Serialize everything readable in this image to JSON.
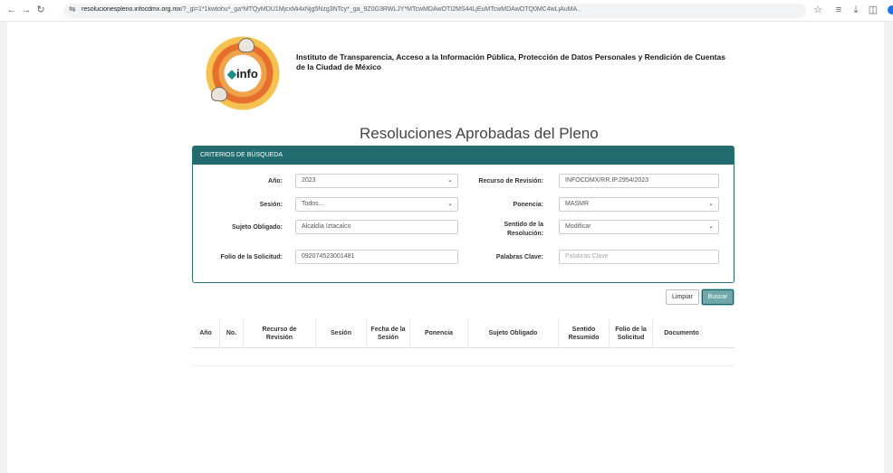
{
  "browser": {
    "url_host": "resolucionespleno.infocdmx.org.mx",
    "url_rest": "/?_gl=1*1kwtohu*_ga*MTQyMDU1MjcxMi4xNjg5Nzg3NTcy*_ga_9Z0G3RWLJY*MTcwMDAwOTI2MS44LjEuMTcwMDAwOTQ0MC4wLjAuMA.."
  },
  "header": {
    "logo_text": "info",
    "institution": "Instituto de Transparencia, Acceso a la Información Pública, Protección de Datos Personales y Rendición de Cuentas de la Ciudad de México"
  },
  "title": "Resoluciones Aprobadas del Pleno",
  "panel": {
    "heading": "CRITERIOS DE BÚSQUEDA",
    "ano_label": "Año:",
    "ano_value": "2023",
    "recurso_label": "Recurso de Revisión:",
    "recurso_value": "INFOCDMX/RR.IP.2954/2023",
    "sesion_label": "Sesión:",
    "sesion_value": "Todos...",
    "ponencia_label": "Ponencia:",
    "ponencia_value": "MASMR",
    "sujeto_label": "Sujeto Obligado:",
    "sujeto_value": "Alcaldía Iztacalco",
    "sentido_label_1": "Sentido de la",
    "sentido_label_2": "Resolución:",
    "sentido_value": "Modificar",
    "folio_label": "Folio de la Solicitud:",
    "folio_value": "092074523001481",
    "palabras_label": "Palabras Clave:",
    "palabras_placeholder": "Palabras Clave"
  },
  "buttons": {
    "limpiar": "Limpiar",
    "buscar": "Buscar"
  },
  "table": {
    "headers": [
      {
        "l1": "Año",
        "l2": ""
      },
      {
        "l1": "No.",
        "l2": ""
      },
      {
        "l1": "Recurso de",
        "l2": "Revisión"
      },
      {
        "l1": "Sesión",
        "l2": ""
      },
      {
        "l1": "Fecha de la",
        "l2": "Sesión"
      },
      {
        "l1": "Ponencia",
        "l2": ""
      },
      {
        "l1": "Sujeto Obligado",
        "l2": ""
      },
      {
        "l1": "Sentido",
        "l2": "Resumido"
      },
      {
        "l1": "Folio de la",
        "l2": "Solicitud"
      },
      {
        "l1": "Documento",
        "l2": ""
      }
    ]
  }
}
